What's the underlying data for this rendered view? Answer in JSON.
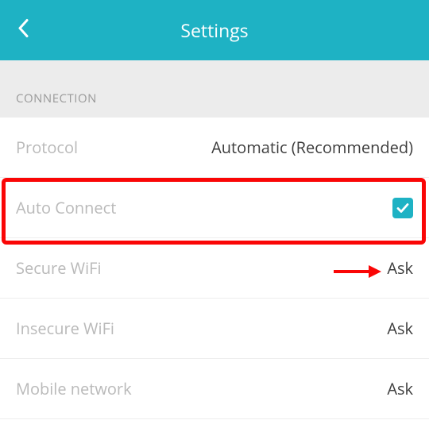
{
  "header": {
    "title": "Settings"
  },
  "section": {
    "title": "CONNECTION"
  },
  "rows": {
    "protocol": {
      "label": "Protocol",
      "value": "Automatic (Recommended)"
    },
    "auto_connect": {
      "label": "Auto Connect",
      "checked": true
    },
    "secure_wifi": {
      "label": "Secure WiFi",
      "value": "Ask"
    },
    "insecure_wifi": {
      "label": "Insecure WiFi",
      "value": "Ask"
    },
    "mobile_network": {
      "label": "Mobile network",
      "value": "Ask"
    }
  },
  "colors": {
    "accent": "#1eb2c4",
    "highlight": "#fa0606"
  }
}
